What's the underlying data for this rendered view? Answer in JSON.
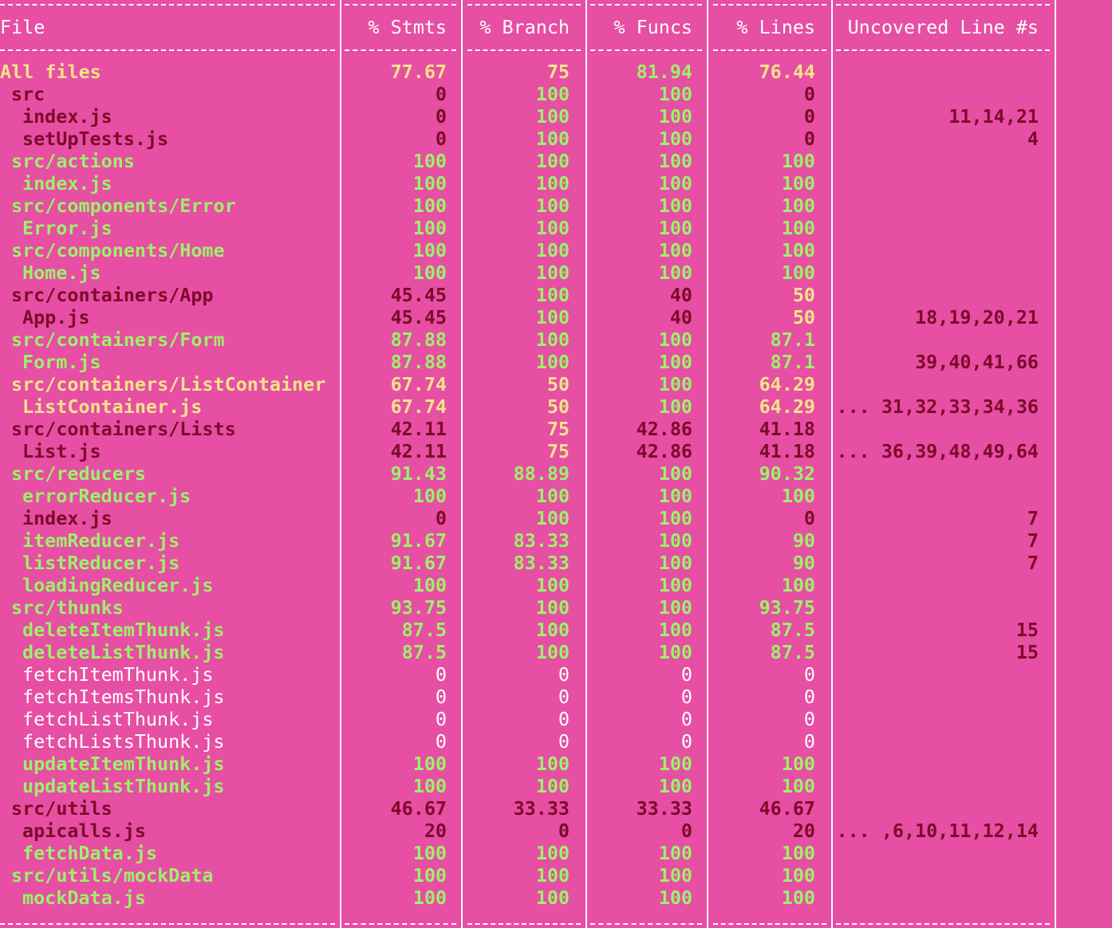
{
  "colors": {
    "background": "#e64fa3",
    "high": "#9ff06a",
    "medium": "#f4e38a",
    "low": "#7d0a2a",
    "none": "#ffffff"
  },
  "headers": {
    "file": "File",
    "stmts": "% Stmts",
    "branch": "% Branch",
    "funcs": "% Funcs",
    "lines": "% Lines",
    "uncovered": "Uncovered Line #s"
  },
  "rows": [
    {
      "file": "All files",
      "stmts": "77.67",
      "branch": "75",
      "funcs": "81.94",
      "lines": "76.44",
      "uncovered": "",
      "indent": 0,
      "fc": "y",
      "sc": "y",
      "bc": "y",
      "uc": "g",
      "lc": "y"
    },
    {
      "file": "src",
      "stmts": "0",
      "branch": "100",
      "funcs": "100",
      "lines": "0",
      "uncovered": "",
      "indent": 1,
      "fc": "r",
      "sc": "r",
      "bc": "g",
      "uc": "g",
      "lc": "r"
    },
    {
      "file": "index.js",
      "stmts": "0",
      "branch": "100",
      "funcs": "100",
      "lines": "0",
      "uncovered": "11,14,21",
      "indent": 2,
      "fc": "r",
      "sc": "r",
      "bc": "g",
      "uc": "g",
      "lc": "r"
    },
    {
      "file": "setUpTests.js",
      "stmts": "0",
      "branch": "100",
      "funcs": "100",
      "lines": "0",
      "uncovered": "4",
      "indent": 2,
      "fc": "r",
      "sc": "r",
      "bc": "g",
      "uc": "g",
      "lc": "r"
    },
    {
      "file": "src/actions",
      "stmts": "100",
      "branch": "100",
      "funcs": "100",
      "lines": "100",
      "uncovered": "",
      "indent": 1,
      "fc": "g",
      "sc": "g",
      "bc": "g",
      "uc": "g",
      "lc": "g"
    },
    {
      "file": "index.js",
      "stmts": "100",
      "branch": "100",
      "funcs": "100",
      "lines": "100",
      "uncovered": "",
      "indent": 2,
      "fc": "g",
      "sc": "g",
      "bc": "g",
      "uc": "g",
      "lc": "g"
    },
    {
      "file": "src/components/Error",
      "stmts": "100",
      "branch": "100",
      "funcs": "100",
      "lines": "100",
      "uncovered": "",
      "indent": 1,
      "fc": "g",
      "sc": "g",
      "bc": "g",
      "uc": "g",
      "lc": "g"
    },
    {
      "file": "Error.js",
      "stmts": "100",
      "branch": "100",
      "funcs": "100",
      "lines": "100",
      "uncovered": "",
      "indent": 2,
      "fc": "g",
      "sc": "g",
      "bc": "g",
      "uc": "g",
      "lc": "g"
    },
    {
      "file": "src/components/Home",
      "stmts": "100",
      "branch": "100",
      "funcs": "100",
      "lines": "100",
      "uncovered": "",
      "indent": 1,
      "fc": "g",
      "sc": "g",
      "bc": "g",
      "uc": "g",
      "lc": "g"
    },
    {
      "file": "Home.js",
      "stmts": "100",
      "branch": "100",
      "funcs": "100",
      "lines": "100",
      "uncovered": "",
      "indent": 2,
      "fc": "g",
      "sc": "g",
      "bc": "g",
      "uc": "g",
      "lc": "g"
    },
    {
      "file": "src/containers/App",
      "stmts": "45.45",
      "branch": "100",
      "funcs": "40",
      "lines": "50",
      "uncovered": "",
      "indent": 1,
      "fc": "r",
      "sc": "r",
      "bc": "g",
      "uc": "r",
      "lc": "y"
    },
    {
      "file": "App.js",
      "stmts": "45.45",
      "branch": "100",
      "funcs": "40",
      "lines": "50",
      "uncovered": "18,19,20,21",
      "indent": 2,
      "fc": "r",
      "sc": "r",
      "bc": "g",
      "uc": "r",
      "lc": "y"
    },
    {
      "file": "src/containers/Form",
      "stmts": "87.88",
      "branch": "100",
      "funcs": "100",
      "lines": "87.1",
      "uncovered": "",
      "indent": 1,
      "fc": "g",
      "sc": "g",
      "bc": "g",
      "uc": "g",
      "lc": "g"
    },
    {
      "file": "Form.js",
      "stmts": "87.88",
      "branch": "100",
      "funcs": "100",
      "lines": "87.1",
      "uncovered": "39,40,41,66",
      "indent": 2,
      "fc": "g",
      "sc": "g",
      "bc": "g",
      "uc": "g",
      "lc": "g"
    },
    {
      "file": "src/containers/ListContainer",
      "stmts": "67.74",
      "branch": "50",
      "funcs": "100",
      "lines": "64.29",
      "uncovered": "",
      "indent": 1,
      "fc": "y",
      "sc": "y",
      "bc": "y",
      "uc": "g",
      "lc": "y"
    },
    {
      "file": "ListContainer.js",
      "stmts": "67.74",
      "branch": "50",
      "funcs": "100",
      "lines": "64.29",
      "uncovered": "... 31,32,33,34,36",
      "indent": 2,
      "fc": "y",
      "sc": "y",
      "bc": "y",
      "uc": "g",
      "lc": "y"
    },
    {
      "file": "src/containers/Lists",
      "stmts": "42.11",
      "branch": "75",
      "funcs": "42.86",
      "lines": "41.18",
      "uncovered": "",
      "indent": 1,
      "fc": "r",
      "sc": "r",
      "bc": "y",
      "uc": "r",
      "lc": "r"
    },
    {
      "file": "List.js",
      "stmts": "42.11",
      "branch": "75",
      "funcs": "42.86",
      "lines": "41.18",
      "uncovered": "... 36,39,48,49,64",
      "indent": 2,
      "fc": "r",
      "sc": "r",
      "bc": "y",
      "uc": "r",
      "lc": "r"
    },
    {
      "file": "src/reducers",
      "stmts": "91.43",
      "branch": "88.89",
      "funcs": "100",
      "lines": "90.32",
      "uncovered": "",
      "indent": 1,
      "fc": "g",
      "sc": "g",
      "bc": "g",
      "uc": "g",
      "lc": "g"
    },
    {
      "file": "errorReducer.js",
      "stmts": "100",
      "branch": "100",
      "funcs": "100",
      "lines": "100",
      "uncovered": "",
      "indent": 2,
      "fc": "g",
      "sc": "g",
      "bc": "g",
      "uc": "g",
      "lc": "g"
    },
    {
      "file": "index.js",
      "stmts": "0",
      "branch": "100",
      "funcs": "100",
      "lines": "0",
      "uncovered": "7",
      "indent": 2,
      "fc": "r",
      "sc": "r",
      "bc": "g",
      "uc": "g",
      "lc": "r"
    },
    {
      "file": "itemReducer.js",
      "stmts": "91.67",
      "branch": "83.33",
      "funcs": "100",
      "lines": "90",
      "uncovered": "7",
      "indent": 2,
      "fc": "g",
      "sc": "g",
      "bc": "g",
      "uc": "g",
      "lc": "g"
    },
    {
      "file": "listReducer.js",
      "stmts": "91.67",
      "branch": "83.33",
      "funcs": "100",
      "lines": "90",
      "uncovered": "7",
      "indent": 2,
      "fc": "g",
      "sc": "g",
      "bc": "g",
      "uc": "g",
      "lc": "g"
    },
    {
      "file": "loadingReducer.js",
      "stmts": "100",
      "branch": "100",
      "funcs": "100",
      "lines": "100",
      "uncovered": "",
      "indent": 2,
      "fc": "g",
      "sc": "g",
      "bc": "g",
      "uc": "g",
      "lc": "g"
    },
    {
      "file": "src/thunks",
      "stmts": "93.75",
      "branch": "100",
      "funcs": "100",
      "lines": "93.75",
      "uncovered": "",
      "indent": 1,
      "fc": "g",
      "sc": "g",
      "bc": "g",
      "uc": "g",
      "lc": "g"
    },
    {
      "file": "deleteItemThunk.js",
      "stmts": "87.5",
      "branch": "100",
      "funcs": "100",
      "lines": "87.5",
      "uncovered": "15",
      "indent": 2,
      "fc": "g",
      "sc": "g",
      "bc": "g",
      "uc": "g",
      "lc": "g"
    },
    {
      "file": "deleteListThunk.js",
      "stmts": "87.5",
      "branch": "100",
      "funcs": "100",
      "lines": "87.5",
      "uncovered": "15",
      "indent": 2,
      "fc": "g",
      "sc": "g",
      "bc": "g",
      "uc": "g",
      "lc": "g"
    },
    {
      "file": "fetchItemThunk.js",
      "stmts": "0",
      "branch": "0",
      "funcs": "0",
      "lines": "0",
      "uncovered": "",
      "indent": 2,
      "fc": "w",
      "sc": "w",
      "bc": "w",
      "uc": "w",
      "lc": "w"
    },
    {
      "file": "fetchItemsThunk.js",
      "stmts": "0",
      "branch": "0",
      "funcs": "0",
      "lines": "0",
      "uncovered": "",
      "indent": 2,
      "fc": "w",
      "sc": "w",
      "bc": "w",
      "uc": "w",
      "lc": "w"
    },
    {
      "file": "fetchListThunk.js",
      "stmts": "0",
      "branch": "0",
      "funcs": "0",
      "lines": "0",
      "uncovered": "",
      "indent": 2,
      "fc": "w",
      "sc": "w",
      "bc": "w",
      "uc": "w",
      "lc": "w"
    },
    {
      "file": "fetchListsThunk.js",
      "stmts": "0",
      "branch": "0",
      "funcs": "0",
      "lines": "0",
      "uncovered": "",
      "indent": 2,
      "fc": "w",
      "sc": "w",
      "bc": "w",
      "uc": "w",
      "lc": "w"
    },
    {
      "file": "updateItemThunk.js",
      "stmts": "100",
      "branch": "100",
      "funcs": "100",
      "lines": "100",
      "uncovered": "",
      "indent": 2,
      "fc": "g",
      "sc": "g",
      "bc": "g",
      "uc": "g",
      "lc": "g"
    },
    {
      "file": "updateListThunk.js",
      "stmts": "100",
      "branch": "100",
      "funcs": "100",
      "lines": "100",
      "uncovered": "",
      "indent": 2,
      "fc": "g",
      "sc": "g",
      "bc": "g",
      "uc": "g",
      "lc": "g"
    },
    {
      "file": "src/utils",
      "stmts": "46.67",
      "branch": "33.33",
      "funcs": "33.33",
      "lines": "46.67",
      "uncovered": "",
      "indent": 1,
      "fc": "r",
      "sc": "r",
      "bc": "r",
      "uc": "r",
      "lc": "r"
    },
    {
      "file": "apicalls.js",
      "stmts": "20",
      "branch": "0",
      "funcs": "0",
      "lines": "20",
      "uncovered": "... ,6,10,11,12,14",
      "indent": 2,
      "fc": "r",
      "sc": "r",
      "bc": "r",
      "uc": "r",
      "lc": "r"
    },
    {
      "file": "fetchData.js",
      "stmts": "100",
      "branch": "100",
      "funcs": "100",
      "lines": "100",
      "uncovered": "",
      "indent": 2,
      "fc": "g",
      "sc": "g",
      "bc": "g",
      "uc": "g",
      "lc": "g"
    },
    {
      "file": "src/utils/mockData",
      "stmts": "100",
      "branch": "100",
      "funcs": "100",
      "lines": "100",
      "uncovered": "",
      "indent": 1,
      "fc": "g",
      "sc": "g",
      "bc": "g",
      "uc": "g",
      "lc": "g"
    },
    {
      "file": "mockData.js",
      "stmts": "100",
      "branch": "100",
      "funcs": "100",
      "lines": "100",
      "uncovered": "",
      "indent": 2,
      "fc": "g",
      "sc": "g",
      "bc": "g",
      "uc": "g",
      "lc": "g"
    }
  ]
}
